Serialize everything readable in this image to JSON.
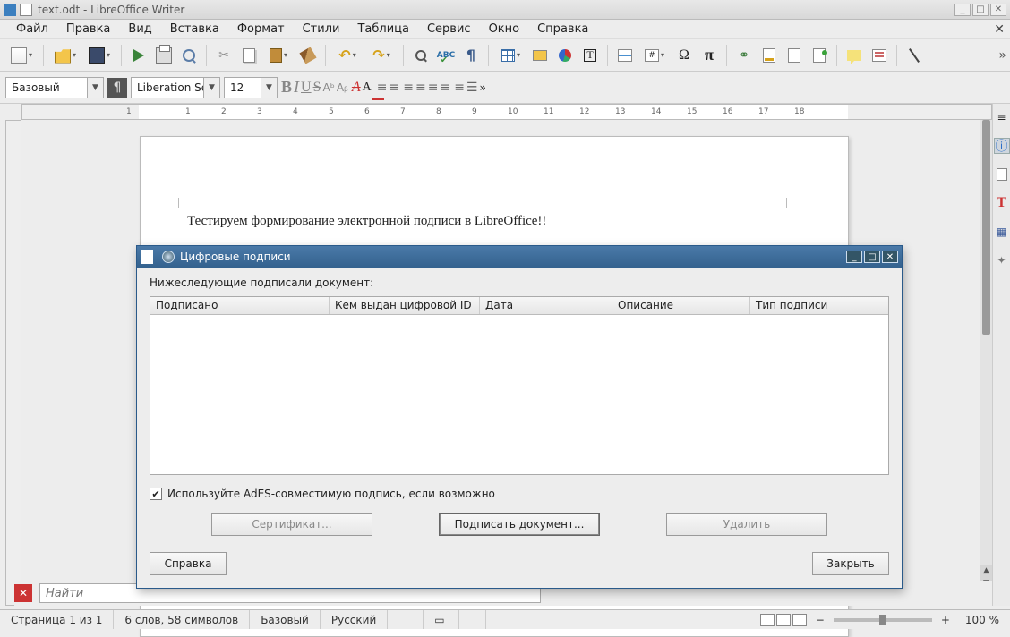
{
  "window": {
    "title": "text.odt - LibreOffice Writer"
  },
  "menus": [
    "Файл",
    "Правка",
    "Вид",
    "Вставка",
    "Формат",
    "Стили",
    "Таблица",
    "Сервис",
    "Окно",
    "Справка"
  ],
  "format": {
    "para_style": "Базовый",
    "font_name": "Liberation Se",
    "font_size": "12"
  },
  "ruler_numbers": [
    1,
    1,
    2,
    3,
    4,
    5,
    6,
    7,
    8,
    9,
    10,
    11,
    12,
    13,
    14,
    15,
    16,
    17,
    18
  ],
  "document_text": "Тестируем формирование электронной подписи в LibreOffice!!",
  "findbar": {
    "placeholder": "Найти"
  },
  "status": {
    "page": "Страница 1 из 1",
    "words": "6 слов, 58 символов",
    "style": "Базовый",
    "lang": "Русский",
    "zoom_minus": "−",
    "zoom_plus": "+",
    "zoom_pct": "100 %"
  },
  "dialog": {
    "title": "Цифровые подписи",
    "intro": "Нижеследующие подписали документ:",
    "columns": [
      "Подписано",
      "Кем выдан цифровой ID",
      "Дата",
      "Описание",
      "Тип подписи"
    ],
    "checkbox": "Используйте AdES-совместимую подпись, если возможно",
    "btn_cert": "Сертификат...",
    "btn_sign": "Подписать документ...",
    "btn_delete": "Удалить",
    "btn_help": "Справка",
    "btn_close": "Закрыть"
  },
  "icons": {
    "spell": "ABC",
    "textframe": "T",
    "field": "#",
    "special": "Ω",
    "pi": "π",
    "cut": "✂",
    "undo": "↶",
    "redo": "↷",
    "link": "⚭",
    "bold": "B",
    "italic": "I",
    "underline": "U",
    "strike": "S",
    "superscript": "Aᵇ",
    "subscript": "Aᵦ",
    "clearfmt": "A",
    "bullets": "≡",
    "numbers": "≡",
    "props": "☰",
    "info": "ⓘ",
    "style_t": "T",
    "gallery": "▦",
    "nav": "✦",
    "collapse": "≡"
  }
}
